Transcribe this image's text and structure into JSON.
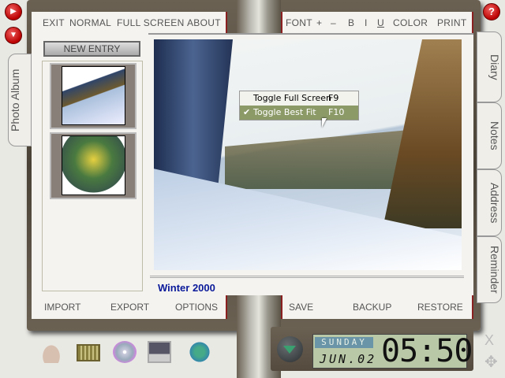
{
  "left_menu": [
    "EXIT",
    "NORMAL",
    "FULL SCREEN",
    "ABOUT"
  ],
  "right_menu": [
    "FONT",
    "+",
    "–",
    "B",
    "I",
    "U",
    "COLOR",
    "PRINT"
  ],
  "new_entry": "NEW ENTRY",
  "left_tab": "Photo Album",
  "right_tabs": [
    "Diary",
    "Notes",
    "Address",
    "Reminder"
  ],
  "caption": "Winter 2000",
  "left_bottom": [
    "IMPORT",
    "EXPORT",
    "OPTIONS"
  ],
  "right_bottom": [
    "SAVE",
    "BACKUP",
    "RESTORE"
  ],
  "context_menu": [
    {
      "label": "Toggle Full Screen",
      "key": "F9",
      "checked": false
    },
    {
      "label": "Toggle Best Fit",
      "key": "F10",
      "checked": true
    }
  ],
  "clock": {
    "day": "SUNDAY",
    "date": "JUN.02",
    "time": "05:50"
  },
  "help": "?",
  "close": "X",
  "check": "✔",
  "colors": {
    "caption": "#0a1a9a",
    "highlight": "#8c9a68"
  }
}
